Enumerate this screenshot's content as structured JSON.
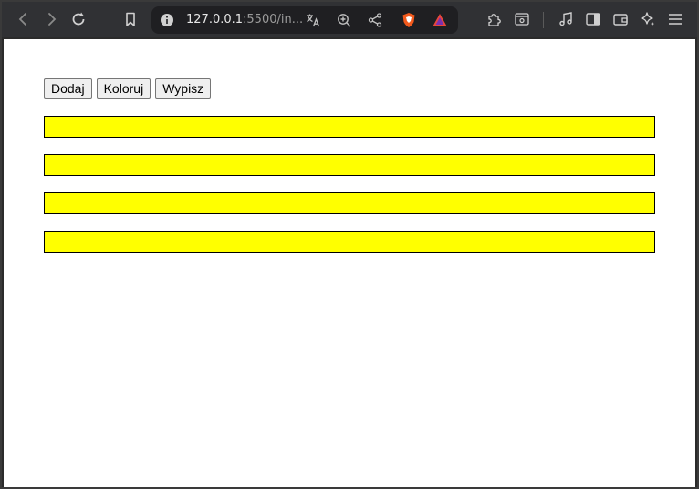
{
  "browser": {
    "url_host": "127.0.0.1",
    "url_rest": ":5500/in...",
    "icons": [
      "back-icon",
      "forward-icon",
      "reload-icon",
      "bookmark-icon",
      "site-info-icon",
      "translate-icon",
      "zoom-icon",
      "share-icon",
      "brave-shields-icon",
      "brave-rewards-icon",
      "extensions-icon",
      "reader-mode-icon",
      "media-icon",
      "sidebar-icon",
      "wallet-icon",
      "leo-ai-icon",
      "menu-icon"
    ]
  },
  "page": {
    "buttons": {
      "add_label": "Dodaj",
      "color_label": "Koloruj",
      "print_label": "Wypisz"
    },
    "bar_color": "#ffff00",
    "bars": [
      {},
      {},
      {},
      {}
    ]
  }
}
